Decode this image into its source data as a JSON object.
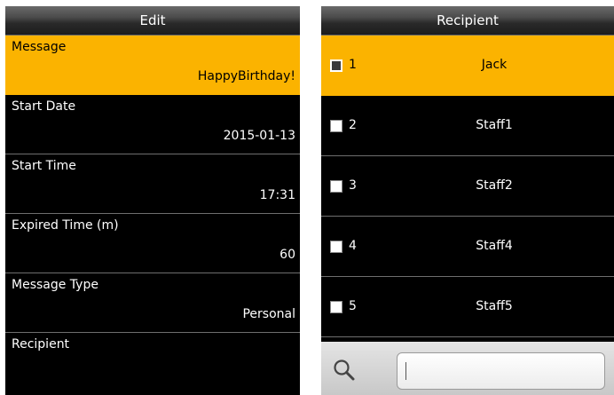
{
  "edit": {
    "title": "Edit",
    "fields": [
      {
        "label": "Message",
        "value": "HappyBirthday!"
      },
      {
        "label": "Start Date",
        "value": "2015-01-13"
      },
      {
        "label": "Start Time",
        "value": "17:31"
      },
      {
        "label": "Expired Time (m)",
        "value": "60"
      },
      {
        "label": "Message Type",
        "value": "Personal"
      },
      {
        "label": "Recipient",
        "value": ""
      }
    ],
    "selected_index": 0
  },
  "recipient": {
    "title": "Recipient",
    "items": [
      {
        "num": "1",
        "name": "Jack"
      },
      {
        "num": "2",
        "name": "Staff1"
      },
      {
        "num": "3",
        "name": "Staff2"
      },
      {
        "num": "4",
        "name": "Staff4"
      },
      {
        "num": "5",
        "name": "Staff5"
      }
    ],
    "selected_index": 0,
    "search": {
      "value": "",
      "icon": "search-icon"
    }
  },
  "colors": {
    "highlight": "#fbb300",
    "background": "#000000",
    "text": "#ffffff"
  }
}
